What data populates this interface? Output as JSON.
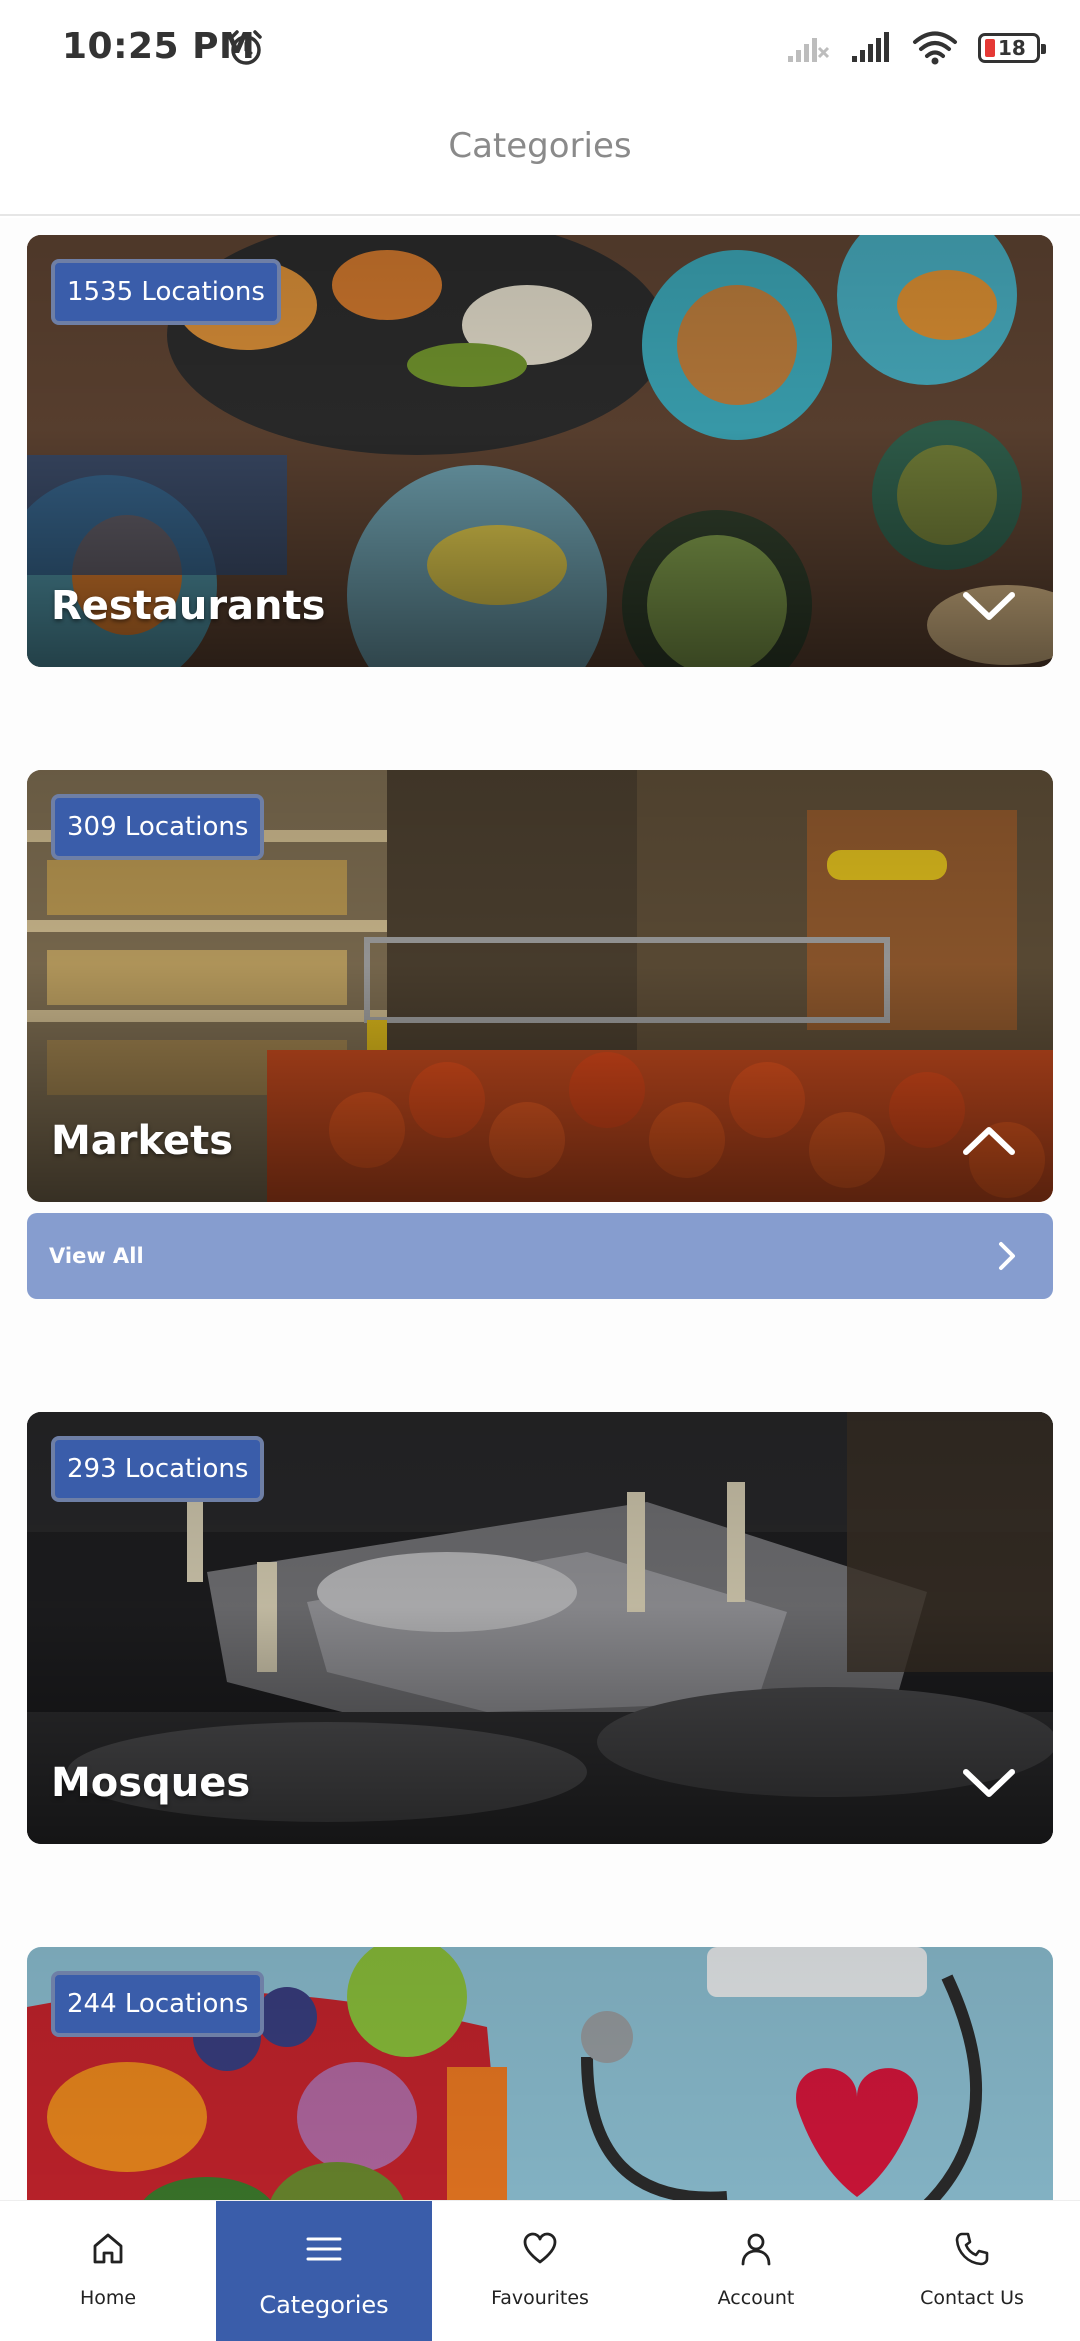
{
  "status": {
    "time": "10:25 PM",
    "battery": "18",
    "icons": [
      "alarm-clock-icon",
      "signal-off-icon",
      "signal-icon",
      "wifi-icon",
      "battery-icon"
    ]
  },
  "header": {
    "title": "Categories"
  },
  "categories": [
    {
      "count": "1535 Locations",
      "name": "Restaurants",
      "expanded": false
    },
    {
      "count": "309 Locations",
      "name": "Markets",
      "expanded": true,
      "view_all": "View All"
    },
    {
      "count": "293 Locations",
      "name": "Mosques",
      "expanded": false
    },
    {
      "count": "244 Locations",
      "name": ""
    }
  ],
  "nav": {
    "items": [
      {
        "label": "Home",
        "icon": "home-icon"
      },
      {
        "label": "Categories",
        "icon": "menu-icon",
        "active": true
      },
      {
        "label": "Favourites",
        "icon": "heart-icon"
      },
      {
        "label": "Account",
        "icon": "user-icon"
      },
      {
        "label": "Contact Us",
        "icon": "phone-icon"
      }
    ]
  },
  "colors": {
    "accent": "#3a5daa",
    "view_all_bg": "#869dcf",
    "header_text": "#8a8a8a"
  }
}
